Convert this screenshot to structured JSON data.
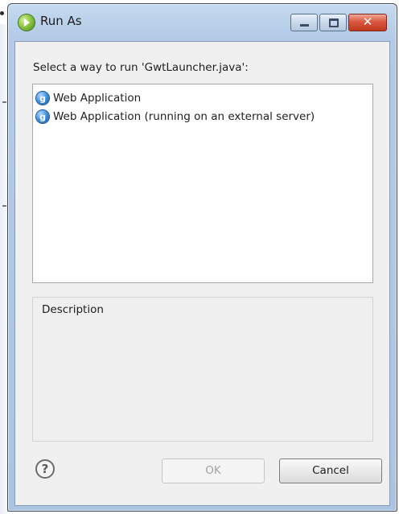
{
  "window": {
    "title": "Run As",
    "close_glyph": "✕"
  },
  "dialog": {
    "prompt": "Select a way to run 'GwtLauncher.java':",
    "options": [
      {
        "label": "Web Application",
        "icon": "gwt-icon",
        "icon_glyph": "g"
      },
      {
        "label": "Web Application (running on an external server)",
        "icon": "gwt-icon",
        "icon_glyph": "g"
      }
    ],
    "description_label": "Description",
    "description_text": ""
  },
  "buttons": {
    "help_glyph": "?",
    "ok_label": "OK",
    "ok_enabled": false,
    "cancel_label": "Cancel"
  },
  "colors": {
    "title_bar": "#b3cbe6",
    "close_button": "#c0391f",
    "dialog_background": "#f0f0f0"
  }
}
